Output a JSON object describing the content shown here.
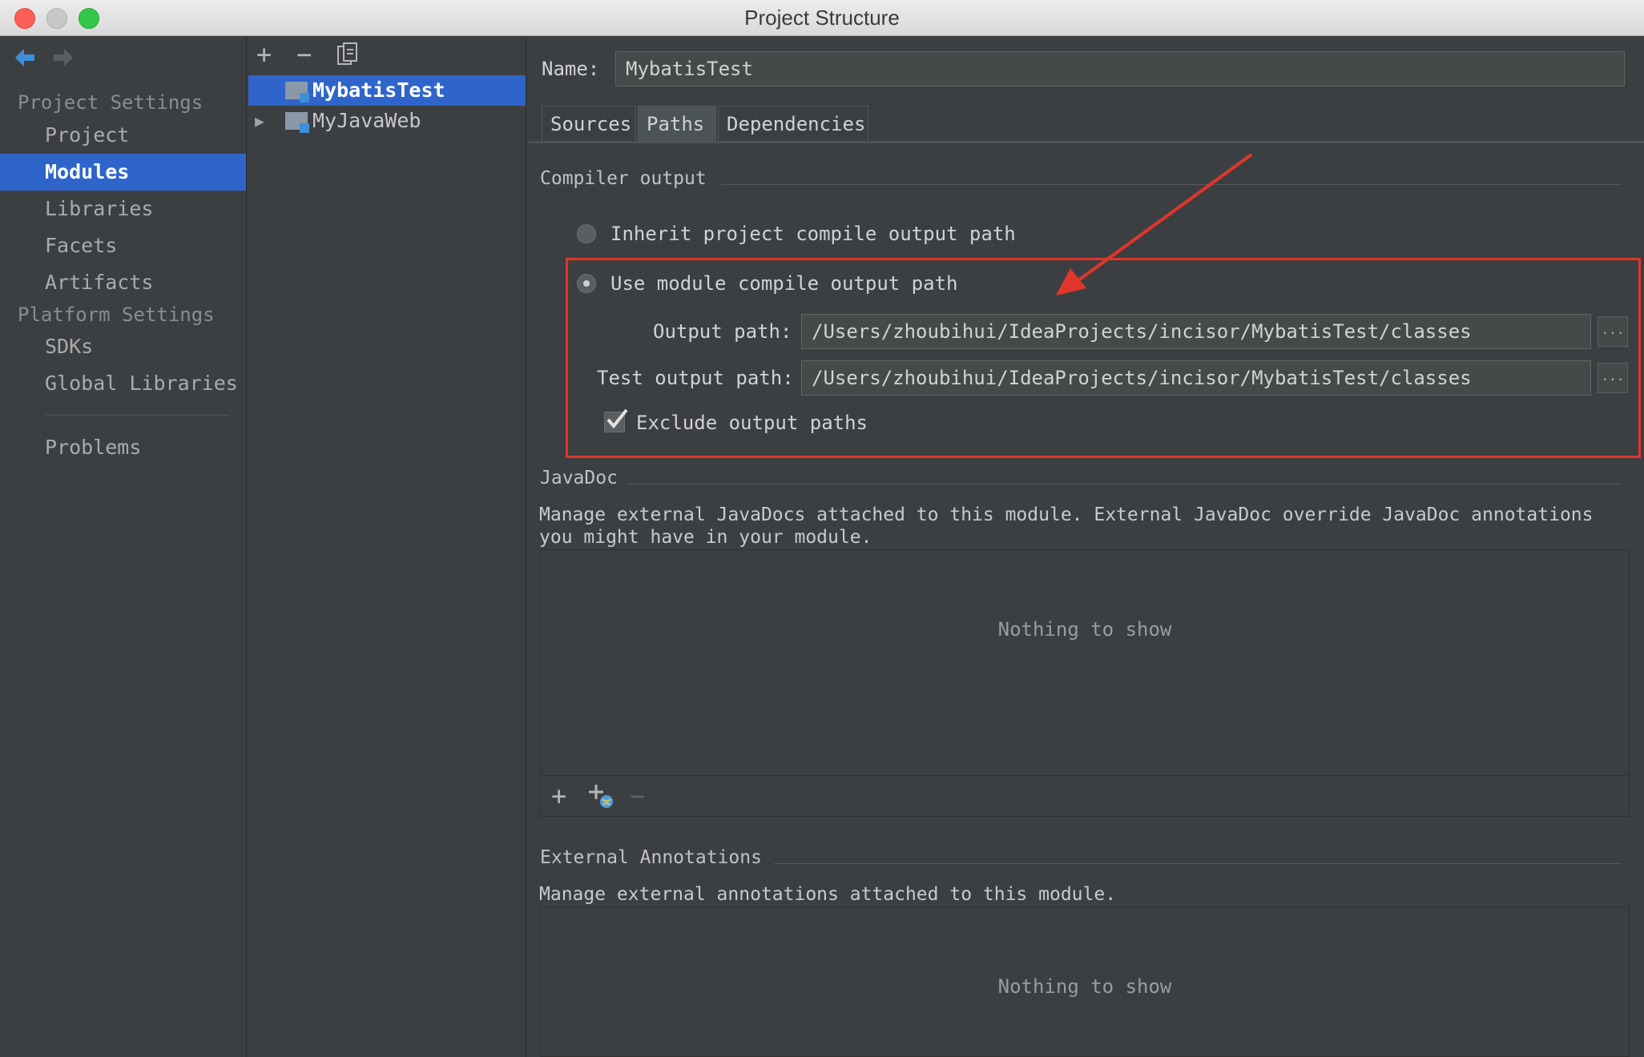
{
  "window": {
    "title": "Project Structure"
  },
  "toolbar": {
    "back_icon": "back-arrow-icon",
    "forward_icon": "forward-arrow-icon",
    "add_symbol": "+",
    "remove_symbol": "−"
  },
  "sidebar": {
    "project_settings_header": "Project Settings",
    "platform_settings_header": "Platform Settings",
    "items": [
      {
        "label": "Project"
      },
      {
        "label": "Modules"
      },
      {
        "label": "Libraries"
      },
      {
        "label": "Facets"
      },
      {
        "label": "Artifacts"
      },
      {
        "label": "SDKs"
      },
      {
        "label": "Global Libraries"
      },
      {
        "label": "Problems"
      }
    ],
    "selected": "Modules"
  },
  "modules_tree": {
    "items": [
      {
        "label": "MybatisTest",
        "selected": true
      },
      {
        "label": "MyJavaWeb",
        "selected": false
      }
    ]
  },
  "module": {
    "name_label": "Name:",
    "name_value": "MybatisTest",
    "tabs": [
      {
        "label": "Sources"
      },
      {
        "label": "Paths"
      },
      {
        "label": "Dependencies"
      }
    ],
    "active_tab": "Paths"
  },
  "compiler_output": {
    "header": "Compiler output",
    "inherit_label": "Inherit project compile output path",
    "use_module_label": "Use module compile output path",
    "output_path_label": "Output path:",
    "output_path_value": "/Users/zhoubihui/IdeaProjects/incisor/MybatisTest/classes",
    "test_output_path_label": "Test output path:",
    "test_output_path_value": "/Users/zhoubihui/IdeaProjects/incisor/MybatisTest/classes",
    "browse_label": "...",
    "exclude_label": "Exclude output paths",
    "exclude_checked": true
  },
  "javadoc": {
    "header": "JavaDoc",
    "description_line1": "Manage external JavaDocs attached to this module. External JavaDoc override JavaDoc annotations",
    "description_line2": "you might have in your module.",
    "empty_text": "Nothing to show"
  },
  "external_annotations": {
    "header": "External Annotations",
    "description": "Manage external annotations attached to this module.",
    "empty_text": "Nothing to show"
  },
  "colors": {
    "selection": "#2f65ca",
    "highlight_box": "#e0362b",
    "background": "#3c3f41"
  }
}
